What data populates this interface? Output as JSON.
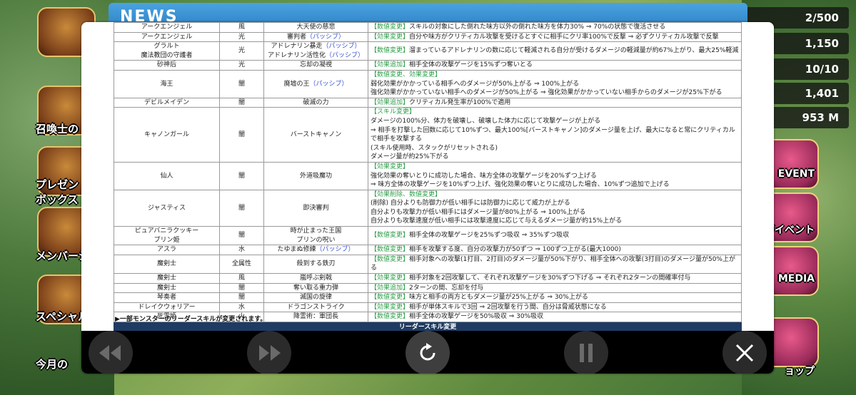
{
  "game": {
    "news_title": "NEWS",
    "right_stats": [
      "2/500",
      "1,150",
      "10/10",
      "1,401",
      "953 M"
    ],
    "left_buttons": [
      "召喚士の",
      "プレゼン\nボックス",
      "メンバーシ",
      "スペシャル",
      "今月の"
    ],
    "right_buttons": [
      "EVENT",
      "ガイベント",
      "MEDIA",
      "ョップ"
    ]
  },
  "table": {
    "rows": [
      {
        "monster": "アークエンジェル",
        "attr": "風",
        "skill": "大天使の慈悲",
        "passive": "",
        "tag": "【数値変更】",
        "desc": [
          "スキルの対象にした倒れた味方以外の倒れた味方を体力30% ⇒ 70%の状態で復活させる"
        ]
      },
      {
        "monster": "アークエンジェル",
        "attr": "光",
        "skill": "審判者",
        "passive": "（パッシブ）",
        "tag": "【効果変更】",
        "desc": [
          "自分や味方がクリティカル攻撃を受けるとすぐに相手にクリ率100%で反撃 ⇒ 必ずクリティカル攻撃で反撃"
        ]
      },
      {
        "monster": "グラルト\n魔法教団の守護者",
        "attr": "光",
        "skill": "アドレナリン暴走",
        "passive": "（パッシブ）",
        "skill2": "アドレナリン活性化",
        "passive2": "（パッシブ）",
        "tag": "【数値変更】",
        "desc": [
          "溜まっているアドレナリンの数に応じて軽減される自分が受けるダメージの軽減量が約67%上がり、最大25%軽減"
        ]
      },
      {
        "monster": "砂神后",
        "attr": "光",
        "skill": "忘却の凝視",
        "passive": "",
        "tag": "【効果追加】",
        "desc": [
          "相手全体の攻撃ゲージを15%ずつ奪いとる"
        ]
      },
      {
        "monster": "海王",
        "attr": "闇",
        "skill": "廃墟の王",
        "passive": "（パッシブ）",
        "tag": "【数値変更、効果変更】",
        "desc": [
          "弱化効果がかかっている相手へのダメージが50%上がる ⇒ 100%上がる",
          "強化効果がかかっていない相手へのダメージが50%上がる ⇒ 強化効果がかかっていない相手からのダメージが25%下がる"
        ]
      },
      {
        "monster": "デビルメイデン",
        "attr": "闇",
        "skill": "破滅の力",
        "passive": "",
        "tag": "【効果追加】",
        "desc": [
          "クリティカル発生率が100%で適用"
        ]
      },
      {
        "monster": "キャノンガール",
        "attr": "闇",
        "skill": "バーストキャノン",
        "passive": "",
        "tag": "【スキル変更】",
        "desc": [
          "ダメージの100%分、体力を破壊し、破壊した体力に応じて攻撃ゲージが上がる",
          "⇒ 相手を打撃した回数に応じて10%ずつ、最大100%[バーストキャノン]のダメージ量を上げ、最大になると常にクリティカルで相手を攻撃する",
          "(スキル使用時、スタックがリセットされる)",
          "ダメージ量が約25%下がる"
        ]
      },
      {
        "monster": "仙人",
        "attr": "闇",
        "skill": "外道吸魔功",
        "passive": "",
        "tag": "【効果変更】",
        "desc": [
          "強化効果の奪いとりに成功した場合、味方全体の攻撃ゲージを20%ずつ上げる",
          "⇒ 味方全体の攻撃ゲージを10%ずつ上げ、強化効果の奪いとりに成功した場合、10%ずつ追加で上げる"
        ]
      },
      {
        "monster": "ジャスティス",
        "attr": "闇",
        "skill": "即決審判",
        "passive": "",
        "tag": "【効果削除、数値変更】",
        "desc": [
          "(削除) 自分よりも防御力が低い相手には防御力に応じて威力が上がる",
          "自分よりも攻撃力が低い相手にはダメージ量が80%上がる ⇒ 100%上がる",
          "自分よりも攻撃速度が低い相手には攻撃速度に応じて与えるダメージ量が約15%上がる"
        ]
      },
      {
        "monster": "ピュアバニラクッキー\nプリン姫",
        "attr": "闇",
        "skill": "時が止まった王国\nプリンの呪い",
        "passive": "",
        "tag": "【数値変更】",
        "desc": [
          "相手全体の攻撃ゲージを25%ずつ吸収 ⇒ 35%ずつ吸収"
        ]
      },
      {
        "monster": "アスラ",
        "attr": "水",
        "skill": "たゆまぬ修練",
        "passive": "（パッシブ）",
        "tag": "【数値変更】",
        "desc": [
          "相手を攻撃する度、自分の攻撃力が50ずつ ⇒ 100ずつ上がる(最大1000)"
        ]
      },
      {
        "monster": "魔剣士",
        "attr": "全属性",
        "skill": "殺到する鉄刃",
        "passive": "",
        "tag": "【数値変更】",
        "desc": [
          "相手対象への攻撃(1打目、2打目)のダメージ量が50%下がり、相手全体への攻撃(3打目)のダメージ量が50%上がる"
        ]
      },
      {
        "monster": "魔剣士",
        "attr": "風",
        "skill": "嵐呼ぶ剣戟",
        "passive": "",
        "tag": "【効果変更】",
        "desc": [
          "相手対象を2回攻撃して、それぞれ攻撃ゲージを30%ずつ下げる ⇒ それぞれ2ターンの間確率付与"
        ]
      },
      {
        "monster": "魔剣士",
        "attr": "闇",
        "skill": "奪い取る重力弾",
        "passive": "",
        "tag": "【効果追加】",
        "desc": [
          "2ターンの間、忘却を付与"
        ]
      },
      {
        "monster": "琴奏者",
        "attr": "闇",
        "skill": "滅国の旋律",
        "passive": "",
        "tag": "【数値変更】",
        "desc": [
          "味方と相手の両方ともダメージ量が25%上がる ⇒ 30%上がる"
        ]
      },
      {
        "monster": "ドレイクウォリアー",
        "attr": "水",
        "skill": "ドラゴンストライク",
        "passive": "",
        "tag": "【効果変更】",
        "desc": [
          "相手が単体スキルで3回 ⇒ 2回攻撃を行う間、自分は脅威状態になる"
        ]
      },
      {
        "monster": "死霊姫",
        "attr": "火",
        "skill": "降霊術：軍団長",
        "passive": "",
        "tag": "【数値変更】",
        "desc": [
          "相手全体の攻撃ゲージを50%吸収 ⇒ 30%吸収"
        ]
      }
    ]
  },
  "note": "▶一部モンスターのリーダースキルが変更されます。",
  "leader_header": "リーダースキル変更",
  "controls": {
    "back": "back-icon",
    "forward": "forward-icon",
    "reload": "reload-icon",
    "pause": "pause-icon",
    "close": "close-icon"
  }
}
